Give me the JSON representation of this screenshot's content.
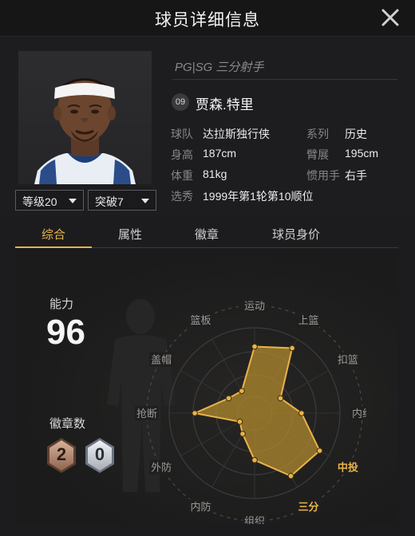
{
  "header": {
    "title": "球员详细信息"
  },
  "player": {
    "position": "PG|SG 三分射手",
    "number": "09",
    "name": "贾森.特里",
    "info": [
      {
        "key": "球队",
        "value": "达拉斯独行侠"
      },
      {
        "key": "系列",
        "value": "历史"
      },
      {
        "key": "身高",
        "value": "187cm"
      },
      {
        "key": "臂展",
        "value": "195cm"
      },
      {
        "key": "体重",
        "value": "81kg"
      },
      {
        "key": "惯用手",
        "value": "右手"
      },
      {
        "key": "选秀",
        "value": "1999年第1轮第10顺位"
      }
    ]
  },
  "selectors": {
    "level": "等级20",
    "breakthrough": "突破7"
  },
  "tabs": [
    "综合",
    "属性",
    "徽章",
    "球员身价"
  ],
  "overview": {
    "ability_label": "能力",
    "ability_value": "96",
    "badge_label": "徽章数",
    "badges": {
      "bronze": "2",
      "silver": "0"
    }
  },
  "radar": {
    "axes": [
      "运动",
      "上篮",
      "扣篮",
      "内线",
      "中投",
      "三分",
      "组织",
      "内防",
      "外防",
      "抢断",
      "盖帽",
      "篮板"
    ],
    "highlighted": [
      "中投",
      "三分"
    ],
    "values": [
      0.78,
      0.88,
      0.35,
      0.55,
      0.88,
      0.85,
      0.55,
      0.28,
      0.2,
      0.7,
      0.35,
      0.3
    ],
    "colors": {
      "fill": "#b08a2e",
      "stroke": "#e9b34a",
      "accent": "#e9b34a"
    }
  }
}
